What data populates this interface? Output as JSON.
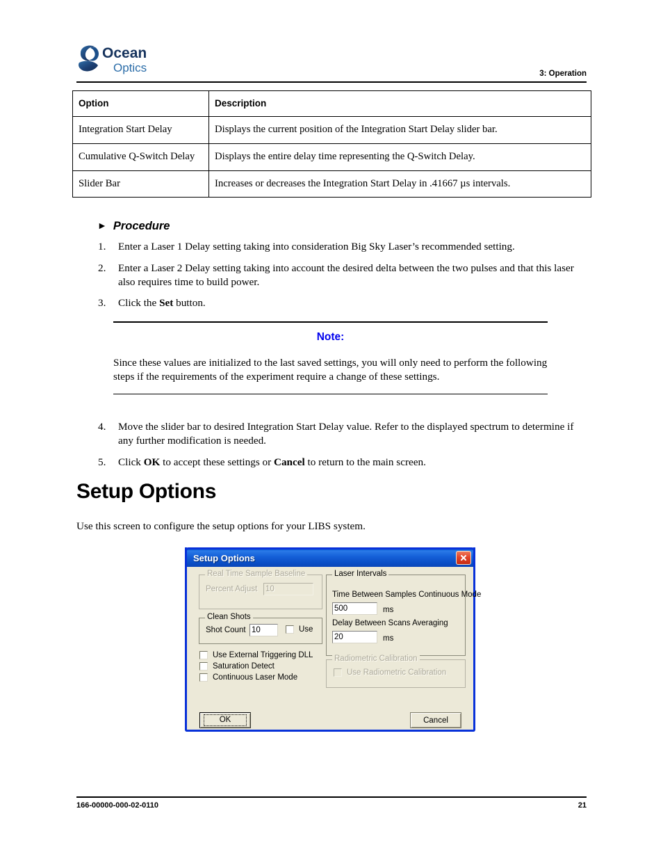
{
  "header": {
    "logo_text_line1": "Ocean",
    "logo_text_line2": "Optics",
    "chapter": "3: Operation"
  },
  "options_table": {
    "columns": [
      "Option",
      "Description"
    ],
    "rows": [
      {
        "option": "Integration Start Delay",
        "description": "Displays the current position of the Integration Start Delay slider bar."
      },
      {
        "option": "Cumulative Q-Switch Delay",
        "description": "Displays the entire delay time representing the Q-Switch Delay."
      },
      {
        "option": "Slider Bar",
        "description": "Increases or decreases the Integration Start Delay in .41667 µs intervals."
      }
    ]
  },
  "procedure": {
    "heading": "Procedure",
    "arrow": "►",
    "steps_before_note": [
      {
        "num": "1.",
        "html": "Enter a Laser 1 Delay setting taking into consideration Big Sky Laser’s recommended setting."
      },
      {
        "num": "2.",
        "html": "Enter a Laser 2 Delay setting taking into account the desired delta between the two pulses and that this laser also requires time to build power."
      },
      {
        "num": "3.",
        "html": "Click the <b>Set</b> button."
      }
    ],
    "steps_after_note": [
      {
        "num": "4.",
        "html": "Move the slider bar to desired Integration Start Delay value. Refer to the displayed spectrum to determine if any further modification is needed."
      },
      {
        "num": "5.",
        "html": "Click <b>OK</b> to accept these settings or <b>Cancel</b> to return to the main screen."
      }
    ]
  },
  "note": {
    "title": "Note:",
    "title_color": "#0000ee",
    "body": "Since these values are initialized to the last saved settings, you will only need to perform the following steps if the requirements of the experiment require a change of these settings."
  },
  "section": {
    "heading": "Setup Options",
    "intro": "Use this screen to configure the setup options for your LIBS system."
  },
  "dialog": {
    "title": "Setup Options",
    "titlebar_color": "#0a50cc",
    "face_color": "#ece9d8",
    "close_icon": "close-icon",
    "groups": {
      "real_time_sample_baseline": {
        "title": "Real Time Sample Baseline",
        "enabled": false,
        "percent_adjust_label": "Percent Adjust",
        "percent_adjust_value": "10"
      },
      "clean_shots": {
        "title": "Clean Shots",
        "shot_count_label": "Shot Count",
        "shot_count_value": "10",
        "use_label": "Use",
        "use_checked": false
      },
      "laser_intervals": {
        "title": "Laser Intervals",
        "time_between_samples_label": "Time Between Samples Continuous Mode",
        "time_between_samples_value": "500",
        "time_between_samples_unit": "ms",
        "delay_between_scans_label": "Delay Between Scans Averaging",
        "delay_between_scans_value": "20",
        "delay_between_scans_unit": "ms"
      },
      "radiometric_calibration": {
        "title": "Radiometric Calibration",
        "enabled": false,
        "use_label": "Use Radiometric Calibration",
        "use_checked": false
      }
    },
    "checkboxes": [
      {
        "label": "Use External Triggering DLL",
        "checked": false
      },
      {
        "label": "Saturation Detect",
        "checked": false
      },
      {
        "label": "Continuous Laser Mode",
        "checked": false
      }
    ],
    "buttons": {
      "ok": "OK",
      "cancel": "Cancel"
    }
  },
  "footer": {
    "doc_number": "166-00000-000-02-0110",
    "page_number": "21"
  }
}
